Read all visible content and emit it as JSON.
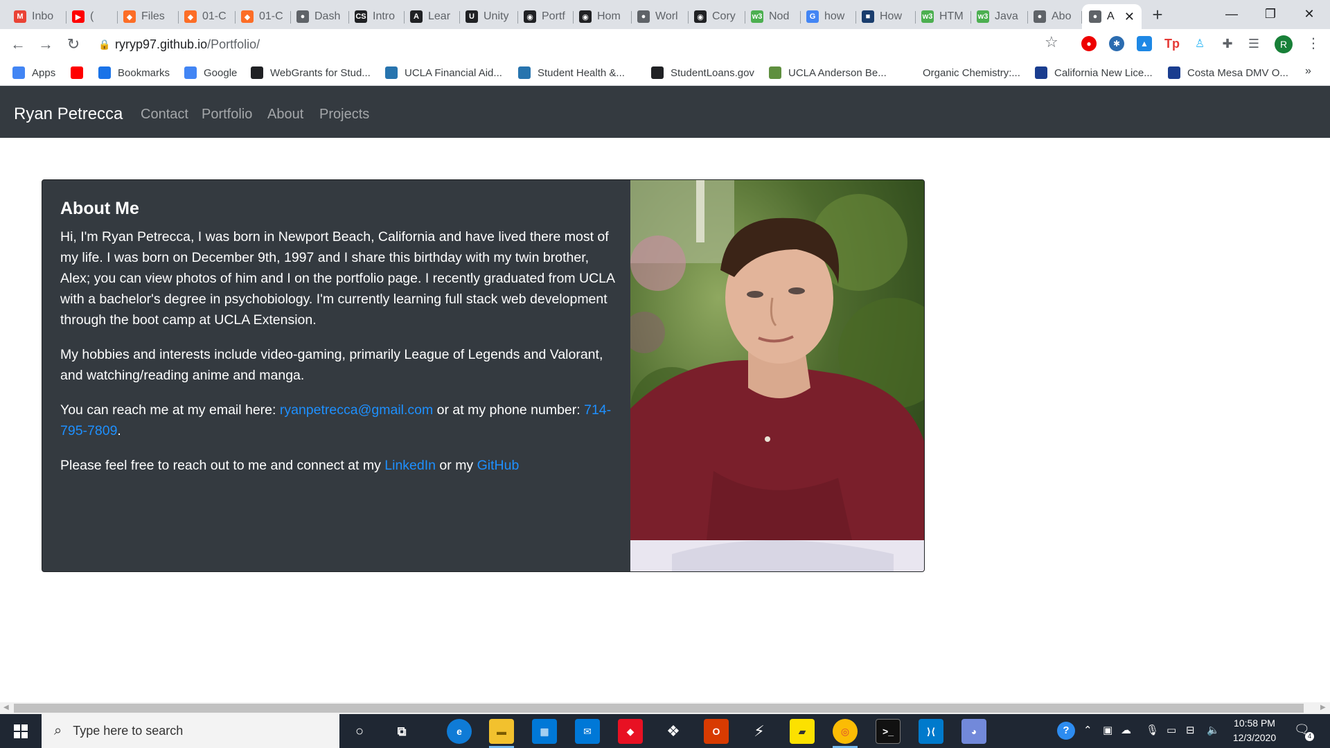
{
  "browser": {
    "tabs": [
      {
        "label": "Inbo",
        "fav": "M",
        "color": "#ea4335"
      },
      {
        "label": "(",
        "fav": "▶",
        "color": "#ff0000"
      },
      {
        "label": "Files",
        "fav": "◆",
        "color": "#fc6d26"
      },
      {
        "label": "01-C",
        "fav": "◆",
        "color": "#fc6d26"
      },
      {
        "label": "01-C",
        "fav": "◆",
        "color": "#fc6d26"
      },
      {
        "label": "Dash",
        "fav": "●",
        "color": "#5f6368"
      },
      {
        "label": "Intro",
        "fav": "CS",
        "color": "#202124"
      },
      {
        "label": "Lear",
        "fav": "A",
        "color": "#202124"
      },
      {
        "label": "Unity",
        "fav": "U",
        "color": "#202124"
      },
      {
        "label": "Portf",
        "fav": "◉",
        "color": "#202124"
      },
      {
        "label": "Hom",
        "fav": "◉",
        "color": "#202124"
      },
      {
        "label": "Worl",
        "fav": "●",
        "color": "#5f6368"
      },
      {
        "label": "Cory",
        "fav": "◉",
        "color": "#202124"
      },
      {
        "label": "Nod",
        "fav": "w3",
        "color": "#4caf50"
      },
      {
        "label": "how",
        "fav": "G",
        "color": "#4285f4"
      },
      {
        "label": "How",
        "fav": "■",
        "color": "#1a3d6d"
      },
      {
        "label": "HTM",
        "fav": "w3",
        "color": "#4caf50"
      },
      {
        "label": "Java",
        "fav": "w3",
        "color": "#4caf50"
      },
      {
        "label": "Abo",
        "fav": "●",
        "color": "#5f6368"
      },
      {
        "label": "A",
        "fav": "●",
        "color": "#5f6368",
        "active": true
      }
    ],
    "new_tab_icon": "+",
    "url_host": "ryryp97.github.io",
    "url_path": "/Portfolio/",
    "profile_initial": "R",
    "bookmarks": [
      {
        "label": "Apps",
        "icon": "apps-grid-icon",
        "color": "#4285f4"
      },
      {
        "label": "",
        "icon": "youtube-icon",
        "color": "#ff0000"
      },
      {
        "label": "Bookmarks",
        "icon": "star-icon",
        "color": "#1a73e8"
      },
      {
        "label": "Google",
        "icon": "google-icon",
        "color": "#4285f4"
      },
      {
        "label": "WebGrants for Stud...",
        "icon": "webgrants-icon",
        "color": "#202124"
      },
      {
        "label": "UCLA Financial Aid...",
        "icon": "ucla-icon",
        "color": "#2774ae"
      },
      {
        "label": "Student Health &...",
        "icon": "ucla-icon",
        "color": "#2774ae"
      },
      {
        "label": "StudentLoans.gov",
        "icon": "fsa-icon",
        "color": "#202124"
      },
      {
        "label": "UCLA Anderson Be...",
        "icon": "anderson-icon",
        "color": "#5f8f3f"
      },
      {
        "label": "Organic Chemistry:...",
        "icon": "",
        "color": "#ffffff"
      },
      {
        "label": "California New Lice...",
        "icon": "dmv-icon",
        "color": "#1a3d8f"
      },
      {
        "label": "Costa Mesa DMV O...",
        "icon": "dmv-icon",
        "color": "#1a3d8f"
      }
    ],
    "bookmarks_more": "»"
  },
  "site": {
    "brand": "Ryan Petrecca",
    "nav": [
      "Contact",
      "Portfolio",
      "About",
      "Projects"
    ],
    "about": {
      "title": "About Me",
      "p1": "Hi, I'm Ryan Petrecca, I was born in Newport Beach, California and have lived there most of my life. I was born on December 9th, 1997 and I share this birthday with my twin brother, Alex; you can view photos of him and I on the portfolio page. I recently graduated from UCLA with a bachelor's degree in psychobiology. I'm currently learning full stack web development through the boot camp at UCLA Extension.",
      "p2": "My hobbies and interests include video-gaming, primarily League of Legends and Valorant, and watching/reading anime and manga.",
      "p3_prefix": "You can reach me at my email here: ",
      "email": "ryanpetrecca@gmail.com",
      "p3_mid": " or at my phone number: ",
      "phone": "714-795-7809",
      "p3_suffix": ".",
      "p4_prefix": "Please feel free to reach out to me and connect at my ",
      "linkedin": "LinkedIn",
      "p4_mid": " or my ",
      "github": "GitHub"
    }
  },
  "taskbar": {
    "search_placeholder": "Type here to search",
    "time": "10:58 PM",
    "date": "12/3/2020",
    "notification_count": "4"
  }
}
